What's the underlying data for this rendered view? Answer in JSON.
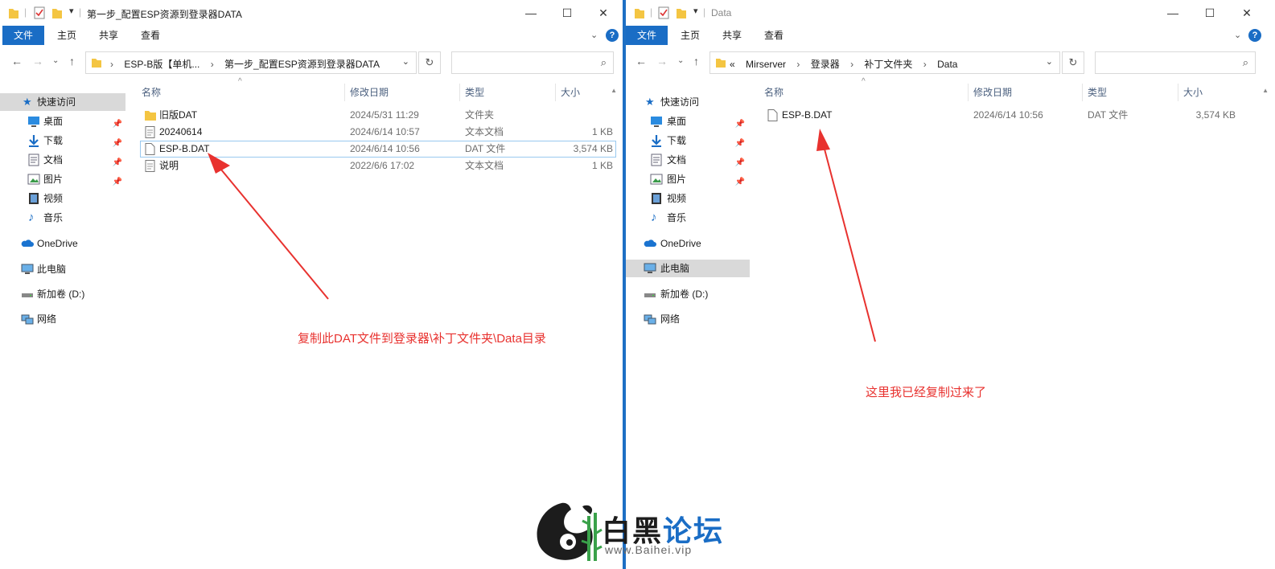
{
  "left_window": {
    "title": "第一步_配置ESP资源到登录器DATA",
    "ribbon_tabs": [
      "文件",
      "主页",
      "共享",
      "查看"
    ],
    "breadcrumb": [
      "ESP-B版【单机...",
      "第一步_配置ESP资源到登录器DATA"
    ],
    "search_placeholder": "",
    "columns": [
      "名称",
      "修改日期",
      "类型",
      "大小"
    ],
    "files": [
      {
        "name": "旧版DAT",
        "date": "2024/5/31 11:29",
        "type": "文件夹",
        "size": "",
        "icon": "folder-icon"
      },
      {
        "name": "20240614",
        "date": "2024/6/14 10:57",
        "type": "文本文档",
        "size": "1 KB",
        "icon": "text-file-icon"
      },
      {
        "name": "ESP-B.DAT",
        "date": "2024/6/14 10:56",
        "type": "DAT 文件",
        "size": "3,574 KB",
        "icon": "file-icon",
        "selected": true
      },
      {
        "name": "说明",
        "date": "2022/6/6 17:02",
        "type": "文本文档",
        "size": "1 KB",
        "icon": "text-file-icon"
      }
    ],
    "annotation": "复制此DAT文件到登录器\\补丁文件夹\\Data目录"
  },
  "right_window": {
    "title": "Data",
    "ribbon_tabs": [
      "文件",
      "主页",
      "共享",
      "查看"
    ],
    "breadcrumb": [
      "«",
      "Mirserver",
      "登录器",
      "补丁文件夹",
      "Data"
    ],
    "search_placeholder": "",
    "columns": [
      "名称",
      "修改日期",
      "类型",
      "大小"
    ],
    "files": [
      {
        "name": "ESP-B.DAT",
        "date": "2024/6/14 10:56",
        "type": "DAT 文件",
        "size": "3,574 KB",
        "icon": "file-icon"
      }
    ],
    "annotation": "这里我已经复制过来了"
  },
  "nav_pane": {
    "quick_access": "快速访问",
    "items": [
      "桌面",
      "下载",
      "文档",
      "图片",
      "视频",
      "音乐"
    ],
    "onedrive": "OneDrive",
    "this_pc": "此电脑",
    "drive": "新加卷 (D:)",
    "network": "网络"
  },
  "watermark": {
    "brand_white": "白黑",
    "brand_blue": "论坛",
    "url": "www.Baihei.vip"
  },
  "colors": {
    "accent": "#1a6dc5",
    "annotation": "#e8322f",
    "selection_border": "#99c9ef",
    "nav_selected": "#d9d9d9"
  }
}
